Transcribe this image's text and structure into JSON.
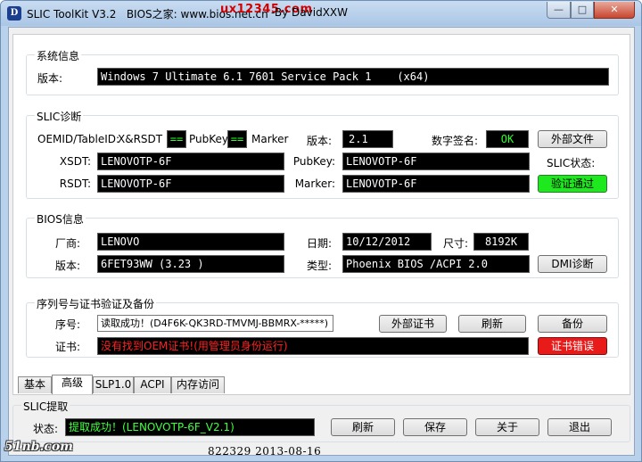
{
  "window": {
    "title_app": "SLIC ToolKit V3.2",
    "title_site": "BIOS之家: www.bios.net.cn",
    "title_author": "-By DavidXXW",
    "watermark_top": "ux12345.com",
    "min_glyph": "—",
    "max_glyph": "□",
    "close_glyph": "✕"
  },
  "system_info": {
    "title": "系统信息",
    "version_label": "版本:",
    "version_value": "Windows 7 Ultimate 6.1 7601 Service Pack 1    (x64)"
  },
  "slic_diag": {
    "title": "SLIC诊断",
    "oemid_label": "OEMID/TableID:",
    "oemid_value": "X&RSDT",
    "eq1": "==",
    "pubkey_tag": "PubKey",
    "eq2": "==",
    "marker_tag": "Marker",
    "version_label": "版本:",
    "version_value": "2.1",
    "signature_label": "数字签名:",
    "signature_value": "OK",
    "external_file_button": "外部文件",
    "xsdt_label": "XSDT:",
    "xsdt_value": "LENOVOTP-6F",
    "pubkey_label": "PubKey:",
    "pubkey_value": "LENOVOTP-6F",
    "slic_status_label": "SLIC状态:",
    "slic_status_button": "验证通过",
    "rsdt_label": "RSDT:",
    "rsdt_value": "LENOVOTP-6F",
    "marker_label": "Marker:",
    "marker_value": "LENOVOTP-6F"
  },
  "bios_info": {
    "title": "BIOS信息",
    "vendor_label": "厂商:",
    "vendor_value": "LENOVO",
    "date_label": "日期:",
    "date_value": "10/12/2012",
    "size_label": "尺寸:",
    "size_value": "8192K",
    "version_label": "版本:",
    "version_value": "6FET93WW (3.23 )",
    "type_label": "类型:",
    "type_value": "Phoenix BIOS /ACPI 2.0",
    "dmi_button": "DMI诊断"
  },
  "serial_cert": {
    "title": "序列号与证书验证及备份",
    "serial_label": "序号:",
    "serial_value": "读取成功！(D4F6K-QK3RD-TMVMJ-BBMRX-*****)",
    "external_cert_button": "外部证书",
    "refresh_button": "刷新",
    "backup_button": "备份",
    "cert_label": "证书:",
    "cert_value": "没有找到OEM证书!(用管理员身份运行)",
    "cert_error_button": "证书错误"
  },
  "tabs": [
    {
      "label": "基本"
    },
    {
      "label": "高级"
    },
    {
      "label": "SLP1.0"
    },
    {
      "label": "ACPI"
    },
    {
      "label": "内存访问"
    }
  ],
  "slic_extract": {
    "title": "SLIC提取",
    "status_label": "状态:",
    "status_value": "提取成功！(LENOVOTP-6F_V2.1)",
    "refresh_button": "刷新",
    "save_button": "保存",
    "about_button": "关于",
    "exit_button": "退出"
  },
  "footer": {
    "watermark": "51nb.com",
    "build_info": "822329   2013-08-16"
  }
}
